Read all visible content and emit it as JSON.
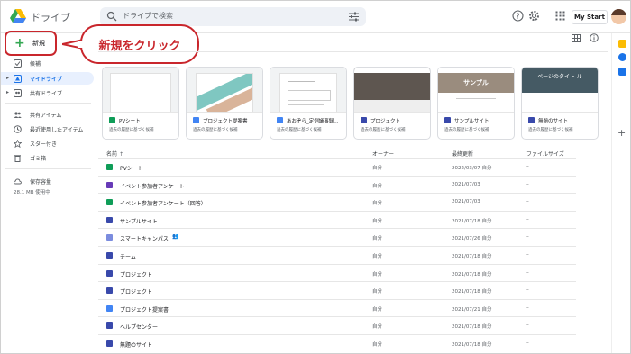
{
  "app": {
    "title": "ドライブ"
  },
  "search": {
    "placeholder": "ドライブで検索"
  },
  "topbar": {
    "mystart_label": "My Start"
  },
  "new_button": {
    "label": "新規"
  },
  "callout": {
    "text": "新規をクリック"
  },
  "sidebar": {
    "items": [
      {
        "label": "候補",
        "icon": "check-square-icon"
      },
      {
        "label": "マイドライブ",
        "icon": "my-drive-icon"
      },
      {
        "label": "共有ドライブ",
        "icon": "shared-drive-icon"
      },
      {
        "label": "共有アイテム",
        "icon": "people-icon"
      },
      {
        "label": "最近使用したアイテム",
        "icon": "clock-icon"
      },
      {
        "label": "スター付き",
        "icon": "star-icon"
      },
      {
        "label": "ゴミ箱",
        "icon": "trash-icon"
      },
      {
        "label": "保存容量",
        "icon": "cloud-icon"
      }
    ],
    "storage_used": "28.1 MB 使用中"
  },
  "suggested": [
    {
      "title": "PVシート",
      "subtitle": "過去の履歴に基づく候補",
      "icon": "sheets-icon",
      "color": "#0f9d58"
    },
    {
      "title": "プロジェクト提案書",
      "subtitle": "過去の履歴に基づく候補",
      "icon": "docs-icon",
      "color": "#4285f4"
    },
    {
      "title": "あおぞら_定例議事録...",
      "subtitle": "過去の履歴に基づく候補",
      "icon": "docs-icon",
      "color": "#4285f4"
    },
    {
      "title": "プロジェクト",
      "subtitle": "過去の履歴に基づく候補",
      "icon": "sites-icon",
      "color": "#3949ab"
    },
    {
      "title": "サンプルサイト",
      "subtitle": "過去の履歴に基づく候補",
      "icon": "sites-icon",
      "color": "#3949ab"
    },
    {
      "title": "無題のサイト",
      "subtitle": "過去の履歴に基づく候補",
      "icon": "sites-icon",
      "color": "#3949ab"
    }
  ],
  "thumb_text": {
    "sample_site": "サンプル",
    "page_title": "ページのタイト ル"
  },
  "columns": {
    "name": "名前",
    "owner": "オーナー",
    "modified": "最終更新",
    "size": "ファイルサイズ"
  },
  "files": [
    {
      "name": "PVシート",
      "owner": "自分",
      "modified": "2022/03/07 自分",
      "size": "–",
      "color": "#0f9d58"
    },
    {
      "name": "イベント参加者アンケート",
      "owner": "自分",
      "modified": "2021/07/03",
      "size": "–",
      "color": "#673ab7"
    },
    {
      "name": "イベント参加者アンケート（回答）",
      "owner": "自分",
      "modified": "2021/07/03",
      "size": "–",
      "color": "#0f9d58"
    },
    {
      "name": "サンプルサイト",
      "owner": "自分",
      "modified": "2021/07/18 自分",
      "size": "–",
      "color": "#3949ab"
    },
    {
      "name": "スマートキャンパス",
      "owner": "自分",
      "modified": "2021/07/26 自分",
      "size": "–",
      "color": "#7b8cde",
      "shared": true
    },
    {
      "name": "チーム",
      "owner": "自分",
      "modified": "2021/07/18 自分",
      "size": "–",
      "color": "#3949ab"
    },
    {
      "name": "プロジェクト",
      "owner": "自分",
      "modified": "2021/07/18 自分",
      "size": "–",
      "color": "#3949ab"
    },
    {
      "name": "プロジェクト",
      "owner": "自分",
      "modified": "2021/07/18 自分",
      "size": "–",
      "color": "#3949ab"
    },
    {
      "name": "プロジェクト提案書",
      "owner": "自分",
      "modified": "2021/07/21 自分",
      "size": "–",
      "color": "#4285f4"
    },
    {
      "name": "ヘルプセンター",
      "owner": "自分",
      "modified": "2021/07/18 自分",
      "size": "–",
      "color": "#3949ab"
    },
    {
      "name": "無題のサイト",
      "owner": "自分",
      "modified": "2021/07/18 自分",
      "size": "–",
      "color": "#3949ab"
    }
  ],
  "colors": {
    "accent": "#1a73e8",
    "callout": "#c9262c",
    "active_bg": "#e8f0fe"
  }
}
